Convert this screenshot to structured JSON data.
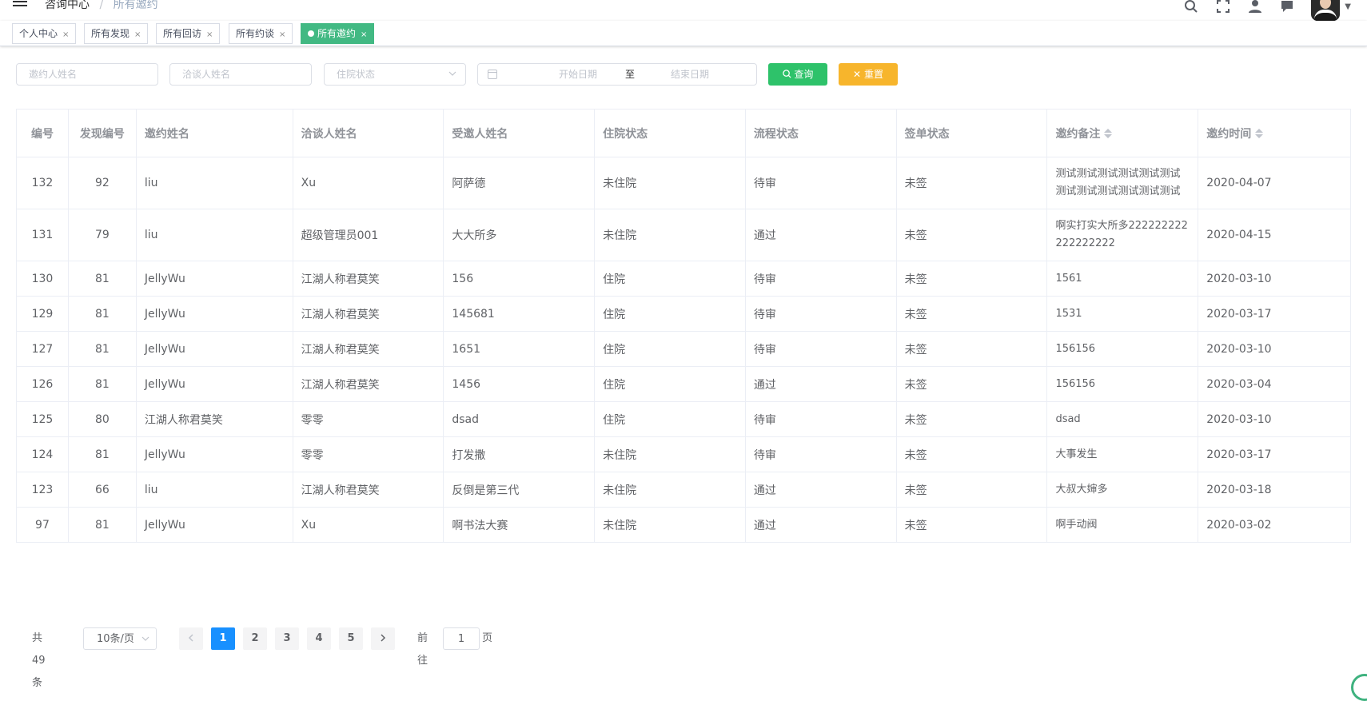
{
  "breadcrumb": {
    "parent": "咨询中心",
    "current": "所有邀约"
  },
  "tags": [
    {
      "label": "个人中心",
      "active": false
    },
    {
      "label": "所有发现",
      "active": false
    },
    {
      "label": "所有回访",
      "active": false
    },
    {
      "label": "所有约谈",
      "active": false
    },
    {
      "label": "所有邀约",
      "active": true
    }
  ],
  "filters": {
    "inviter_placeholder": "邀约人姓名",
    "negotiator_placeholder": "洽谈人姓名",
    "hospital_status_placeholder": "住院状态",
    "start_date_placeholder": "开始日期",
    "range_separator": "至",
    "end_date_placeholder": "结束日期",
    "search_label": "查询",
    "reset_label": "重置"
  },
  "table": {
    "headers": [
      "编号",
      "发现编号",
      "邀约姓名",
      "洽谈人姓名",
      "受邀人姓名",
      "住院状态",
      "流程状态",
      "签单状态",
      "邀约备注",
      "邀约时间"
    ],
    "rows": [
      [
        "132",
        "92",
        "liu",
        "Xu",
        "阿萨德",
        "未住院",
        "待审",
        "未签",
        "测试测试测试测试测试测试测试测试测试测试测试测试",
        "2020-04-07"
      ],
      [
        "131",
        "79",
        "liu",
        "超级管理员001",
        "大大所多",
        "未住院",
        "通过",
        "未签",
        "啊实打实大所多222222222222222222",
        "2020-04-15"
      ],
      [
        "130",
        "81",
        "JellyWu",
        "江湖人称君莫笑",
        "156",
        "住院",
        "待审",
        "未签",
        "1561",
        "2020-03-10"
      ],
      [
        "129",
        "81",
        "JellyWu",
        "江湖人称君莫笑",
        "145681",
        "住院",
        "待审",
        "未签",
        "1531",
        "2020-03-17"
      ],
      [
        "127",
        "81",
        "JellyWu",
        "江湖人称君莫笑",
        "1651",
        "住院",
        "待审",
        "未签",
        "156156",
        "2020-03-10"
      ],
      [
        "126",
        "81",
        "JellyWu",
        "江湖人称君莫笑",
        "1456",
        "住院",
        "通过",
        "未签",
        "156156",
        "2020-03-04"
      ],
      [
        "125",
        "80",
        "江湖人称君莫笑",
        "零零",
        "dsad",
        "住院",
        "待审",
        "未签",
        "dsad",
        "2020-03-10"
      ],
      [
        "124",
        "81",
        "JellyWu",
        "零零",
        "打发撒",
        "未住院",
        "待审",
        "未签",
        "大事发生",
        "2020-03-17"
      ],
      [
        "123",
        "66",
        "liu",
        "江湖人称君莫笑",
        "反倒是第三代",
        "未住院",
        "通过",
        "未签",
        "大叔大婶多",
        "2020-03-18"
      ],
      [
        "97",
        "81",
        "JellyWu",
        "Xu",
        "啊书法大赛",
        "未住院",
        "通过",
        "未签",
        "啊手动阀",
        "2020-03-02"
      ]
    ]
  },
  "pagination": {
    "total_text": "共 49 条",
    "page_size": "10条/页",
    "pages": [
      "1",
      "2",
      "3",
      "4",
      "5"
    ],
    "current_page": "1",
    "goto_prefix": "前往",
    "goto_value": "1",
    "goto_suffix": "页"
  },
  "colors": {
    "active_tag": "#42b983",
    "search_button": "#2ec26a",
    "reset_button": "#f7b52c",
    "active_page": "#1890ff"
  },
  "icons": [
    "hamburger-icon",
    "search-icon",
    "fullscreen-icon",
    "user-icon",
    "message-icon",
    "calendar-icon",
    "sort-icon",
    "chevron-left-icon",
    "chevron-right-icon"
  ]
}
